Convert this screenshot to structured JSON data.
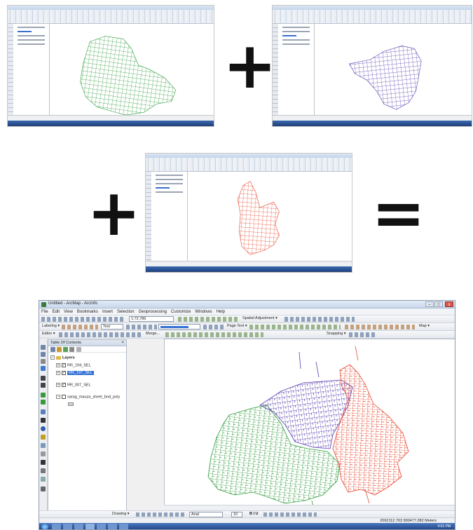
{
  "main_window": {
    "title": "Untitled - ArcMap - ArcInfo",
    "controls": {
      "minimize": "–",
      "maximize": "□",
      "close": "x"
    },
    "menus": [
      "File",
      "Edit",
      "View",
      "Bookmarks",
      "Insert",
      "Selection",
      "Geoprocessing",
      "Customize",
      "Windows",
      "Help"
    ],
    "toolbar": {
      "scale": "1:72,786",
      "spatial_adjustment": "Spatial Adjustment ▾",
      "labeling": "Labeling ▾",
      "text_field": "Text",
      "page_text": "Page Text ▾",
      "map_label": "Map ▾",
      "editor": "Editor ▾",
      "merge": "Merge...",
      "snapping": "Snapping ▾"
    },
    "toc": {
      "title": "Table Of Contents",
      "layers_label": "Layers",
      "layers": [
        {
          "name": "RR_194_SEL",
          "selected": false,
          "checked": true,
          "color": "#2e9c3a"
        },
        {
          "name": "RR_197_SEL",
          "selected": true,
          "checked": true,
          "color": "#5a3fb0"
        },
        {
          "name": "RR_007_SEL",
          "selected": false,
          "checked": true,
          "color": "#e84a32"
        },
        {
          "name": "sarag_mauza_sheet_bnd_poly",
          "selected": false,
          "checked": false,
          "color": "#b6b6b6"
        }
      ]
    },
    "drawing": {
      "label": "Drawing ▾",
      "font": "Arial",
      "font_size": "10",
      "style_buttons": "B I U"
    },
    "status": {
      "coordinates": "2062112.763  990477.082 Meters"
    },
    "taskbar_clock": "4:01 PM"
  },
  "thumbnails": [
    {
      "id": "green",
      "color": "#2e9c3a"
    },
    {
      "id": "purple",
      "color": "#5a3fb0"
    },
    {
      "id": "orange",
      "color": "#e84a32"
    }
  ],
  "operators": {
    "plus": "+",
    "equals": "="
  },
  "colors": {
    "green": "#2e9c3a",
    "purple": "#5a3fb0",
    "orange": "#e84a32",
    "selection": "#3370d4"
  }
}
